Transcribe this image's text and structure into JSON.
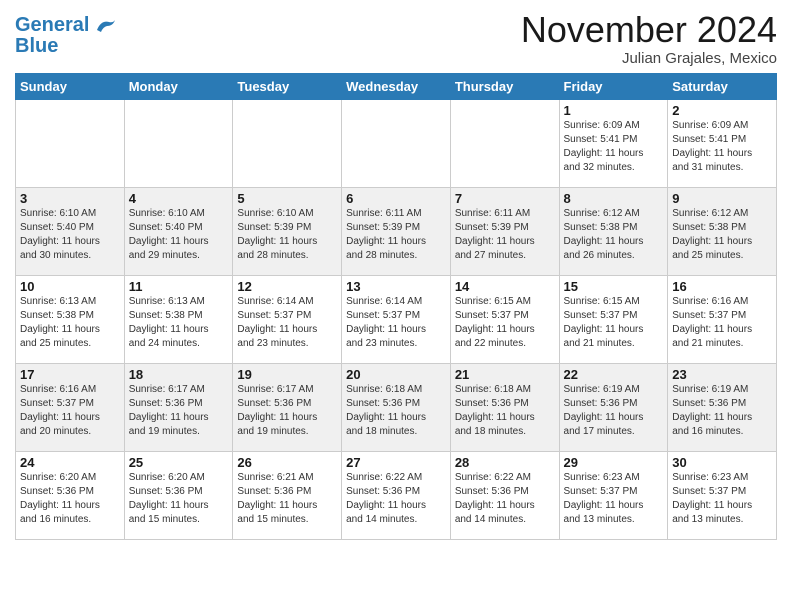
{
  "logo": {
    "line1": "General",
    "line2": "Blue"
  },
  "title": "November 2024",
  "subtitle": "Julian Grajales, Mexico",
  "days_of_week": [
    "Sunday",
    "Monday",
    "Tuesday",
    "Wednesday",
    "Thursday",
    "Friday",
    "Saturday"
  ],
  "weeks": [
    [
      {
        "day": "",
        "info": ""
      },
      {
        "day": "",
        "info": ""
      },
      {
        "day": "",
        "info": ""
      },
      {
        "day": "",
        "info": ""
      },
      {
        "day": "",
        "info": ""
      },
      {
        "day": "1",
        "info": "Sunrise: 6:09 AM\nSunset: 5:41 PM\nDaylight: 11 hours\nand 32 minutes."
      },
      {
        "day": "2",
        "info": "Sunrise: 6:09 AM\nSunset: 5:41 PM\nDaylight: 11 hours\nand 31 minutes."
      }
    ],
    [
      {
        "day": "3",
        "info": "Sunrise: 6:10 AM\nSunset: 5:40 PM\nDaylight: 11 hours\nand 30 minutes."
      },
      {
        "day": "4",
        "info": "Sunrise: 6:10 AM\nSunset: 5:40 PM\nDaylight: 11 hours\nand 29 minutes."
      },
      {
        "day": "5",
        "info": "Sunrise: 6:10 AM\nSunset: 5:39 PM\nDaylight: 11 hours\nand 28 minutes."
      },
      {
        "day": "6",
        "info": "Sunrise: 6:11 AM\nSunset: 5:39 PM\nDaylight: 11 hours\nand 28 minutes."
      },
      {
        "day": "7",
        "info": "Sunrise: 6:11 AM\nSunset: 5:39 PM\nDaylight: 11 hours\nand 27 minutes."
      },
      {
        "day": "8",
        "info": "Sunrise: 6:12 AM\nSunset: 5:38 PM\nDaylight: 11 hours\nand 26 minutes."
      },
      {
        "day": "9",
        "info": "Sunrise: 6:12 AM\nSunset: 5:38 PM\nDaylight: 11 hours\nand 25 minutes."
      }
    ],
    [
      {
        "day": "10",
        "info": "Sunrise: 6:13 AM\nSunset: 5:38 PM\nDaylight: 11 hours\nand 25 minutes."
      },
      {
        "day": "11",
        "info": "Sunrise: 6:13 AM\nSunset: 5:38 PM\nDaylight: 11 hours\nand 24 minutes."
      },
      {
        "day": "12",
        "info": "Sunrise: 6:14 AM\nSunset: 5:37 PM\nDaylight: 11 hours\nand 23 minutes."
      },
      {
        "day": "13",
        "info": "Sunrise: 6:14 AM\nSunset: 5:37 PM\nDaylight: 11 hours\nand 23 minutes."
      },
      {
        "day": "14",
        "info": "Sunrise: 6:15 AM\nSunset: 5:37 PM\nDaylight: 11 hours\nand 22 minutes."
      },
      {
        "day": "15",
        "info": "Sunrise: 6:15 AM\nSunset: 5:37 PM\nDaylight: 11 hours\nand 21 minutes."
      },
      {
        "day": "16",
        "info": "Sunrise: 6:16 AM\nSunset: 5:37 PM\nDaylight: 11 hours\nand 21 minutes."
      }
    ],
    [
      {
        "day": "17",
        "info": "Sunrise: 6:16 AM\nSunset: 5:37 PM\nDaylight: 11 hours\nand 20 minutes."
      },
      {
        "day": "18",
        "info": "Sunrise: 6:17 AM\nSunset: 5:36 PM\nDaylight: 11 hours\nand 19 minutes."
      },
      {
        "day": "19",
        "info": "Sunrise: 6:17 AM\nSunset: 5:36 PM\nDaylight: 11 hours\nand 19 minutes."
      },
      {
        "day": "20",
        "info": "Sunrise: 6:18 AM\nSunset: 5:36 PM\nDaylight: 11 hours\nand 18 minutes."
      },
      {
        "day": "21",
        "info": "Sunrise: 6:18 AM\nSunset: 5:36 PM\nDaylight: 11 hours\nand 18 minutes."
      },
      {
        "day": "22",
        "info": "Sunrise: 6:19 AM\nSunset: 5:36 PM\nDaylight: 11 hours\nand 17 minutes."
      },
      {
        "day": "23",
        "info": "Sunrise: 6:19 AM\nSunset: 5:36 PM\nDaylight: 11 hours\nand 16 minutes."
      }
    ],
    [
      {
        "day": "24",
        "info": "Sunrise: 6:20 AM\nSunset: 5:36 PM\nDaylight: 11 hours\nand 16 minutes."
      },
      {
        "day": "25",
        "info": "Sunrise: 6:20 AM\nSunset: 5:36 PM\nDaylight: 11 hours\nand 15 minutes."
      },
      {
        "day": "26",
        "info": "Sunrise: 6:21 AM\nSunset: 5:36 PM\nDaylight: 11 hours\nand 15 minutes."
      },
      {
        "day": "27",
        "info": "Sunrise: 6:22 AM\nSunset: 5:36 PM\nDaylight: 11 hours\nand 14 minutes."
      },
      {
        "day": "28",
        "info": "Sunrise: 6:22 AM\nSunset: 5:36 PM\nDaylight: 11 hours\nand 14 minutes."
      },
      {
        "day": "29",
        "info": "Sunrise: 6:23 AM\nSunset: 5:37 PM\nDaylight: 11 hours\nand 13 minutes."
      },
      {
        "day": "30",
        "info": "Sunrise: 6:23 AM\nSunset: 5:37 PM\nDaylight: 11 hours\nand 13 minutes."
      }
    ]
  ]
}
